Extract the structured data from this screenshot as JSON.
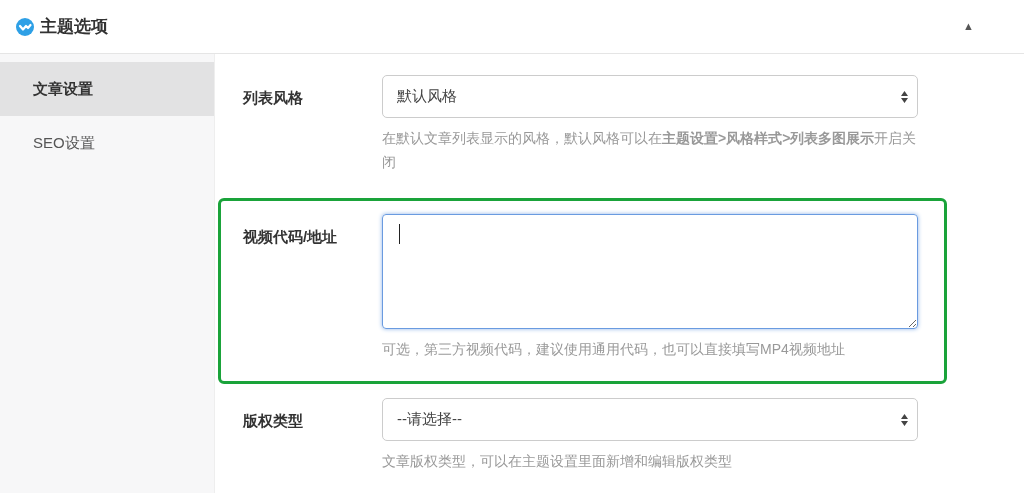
{
  "panel": {
    "title": "主题选项",
    "collapse_toggle": "▲"
  },
  "sidebar": {
    "items": [
      {
        "label": "文章设置",
        "selected": true
      },
      {
        "label": "SEO设置",
        "selected": false
      }
    ]
  },
  "fields": [
    {
      "kind": "select",
      "label": "列表风格",
      "value": "默认风格",
      "help": "在默认文章列表显示的风格，默认风格可以在**主题设置>风格样式>列表多图展示**开启关闭",
      "highlighted": false
    },
    {
      "kind": "textarea",
      "label": "视频代码/地址",
      "help": "可选，第三方视频代码，建议使用通用代码，也可以直接填写MP4视频地址",
      "highlighted": true,
      "focused": true
    },
    {
      "kind": "select",
      "label": "版权类型",
      "value": "--请选择--",
      "help": "文章版权类型，可以在主题设置里面新增和编辑版权类型",
      "highlighted": false
    }
  ]
}
